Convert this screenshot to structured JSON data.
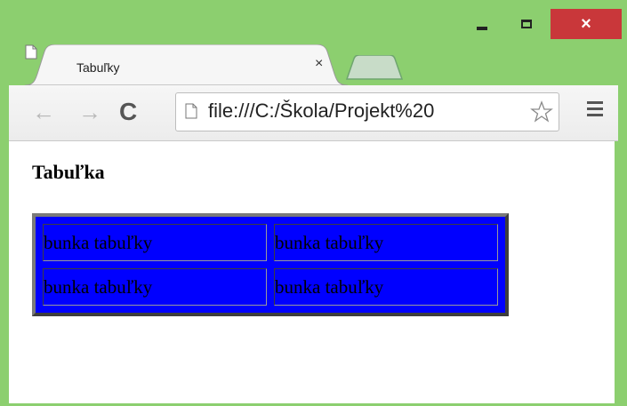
{
  "window": {
    "controls": {
      "minimize_icon": "minimize-icon",
      "maximize_icon": "maximize-icon",
      "close_label": "×"
    }
  },
  "tab": {
    "title": "Tabuľky",
    "close_label": "×",
    "icon": "document-icon"
  },
  "toolbar": {
    "back_label": "←",
    "forward_label": "→",
    "reload_label": "C",
    "url": "file:///C:/Škola/Projekt%20",
    "star_icon": "star-icon",
    "menu_icon": "menu-icon"
  },
  "page": {
    "heading": "Tabuľka",
    "table": {
      "rows": [
        [
          "bunka tabuľky",
          "bunka tabuľky"
        ],
        [
          "bunka tabuľky",
          "bunka tabuľky"
        ]
      ]
    }
  },
  "colors": {
    "frame": "#8ccf6f",
    "close_button": "#c9373a",
    "table_background": "#0000ff"
  }
}
